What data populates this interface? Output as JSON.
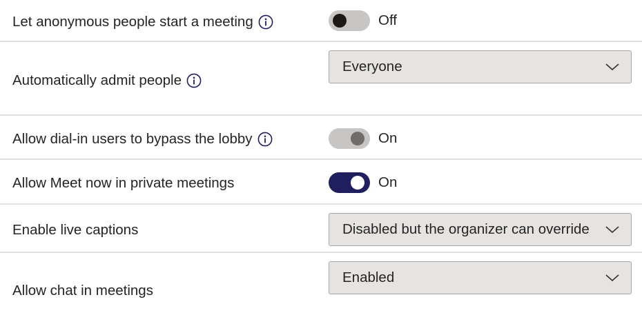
{
  "settings": [
    {
      "label": "Let anonymous people start a meeting",
      "control": "toggle",
      "state": "Off",
      "enabled": true
    },
    {
      "label": "Automatically admit people",
      "control": "dropdown",
      "value": "Everyone"
    },
    {
      "label": "Allow dial-in users to bypass the lobby",
      "control": "toggle",
      "state": "On",
      "enabled": false
    },
    {
      "label": "Allow Meet now in private meetings",
      "control": "toggle",
      "state": "On",
      "enabled": true
    },
    {
      "label": "Enable live captions",
      "control": "dropdown",
      "value": "Disabled but the organizer can override"
    },
    {
      "label": "Allow chat in meetings",
      "control": "dropdown",
      "value": "Enabled"
    }
  ],
  "icons": {
    "info": "info-circle-icon",
    "chevron": "chevron-down-icon"
  },
  "colors": {
    "toggle_on": "#201f5e",
    "toggle_off_track": "#c8c6c4",
    "toggle_off_knob": "#1b1a19",
    "toggle_disabled_track": "#c8c6c4",
    "toggle_disabled_knob": "#6e6d6c",
    "info_icon": "#1f1d5a",
    "dropdown_bg": "#e5e4e3"
  }
}
